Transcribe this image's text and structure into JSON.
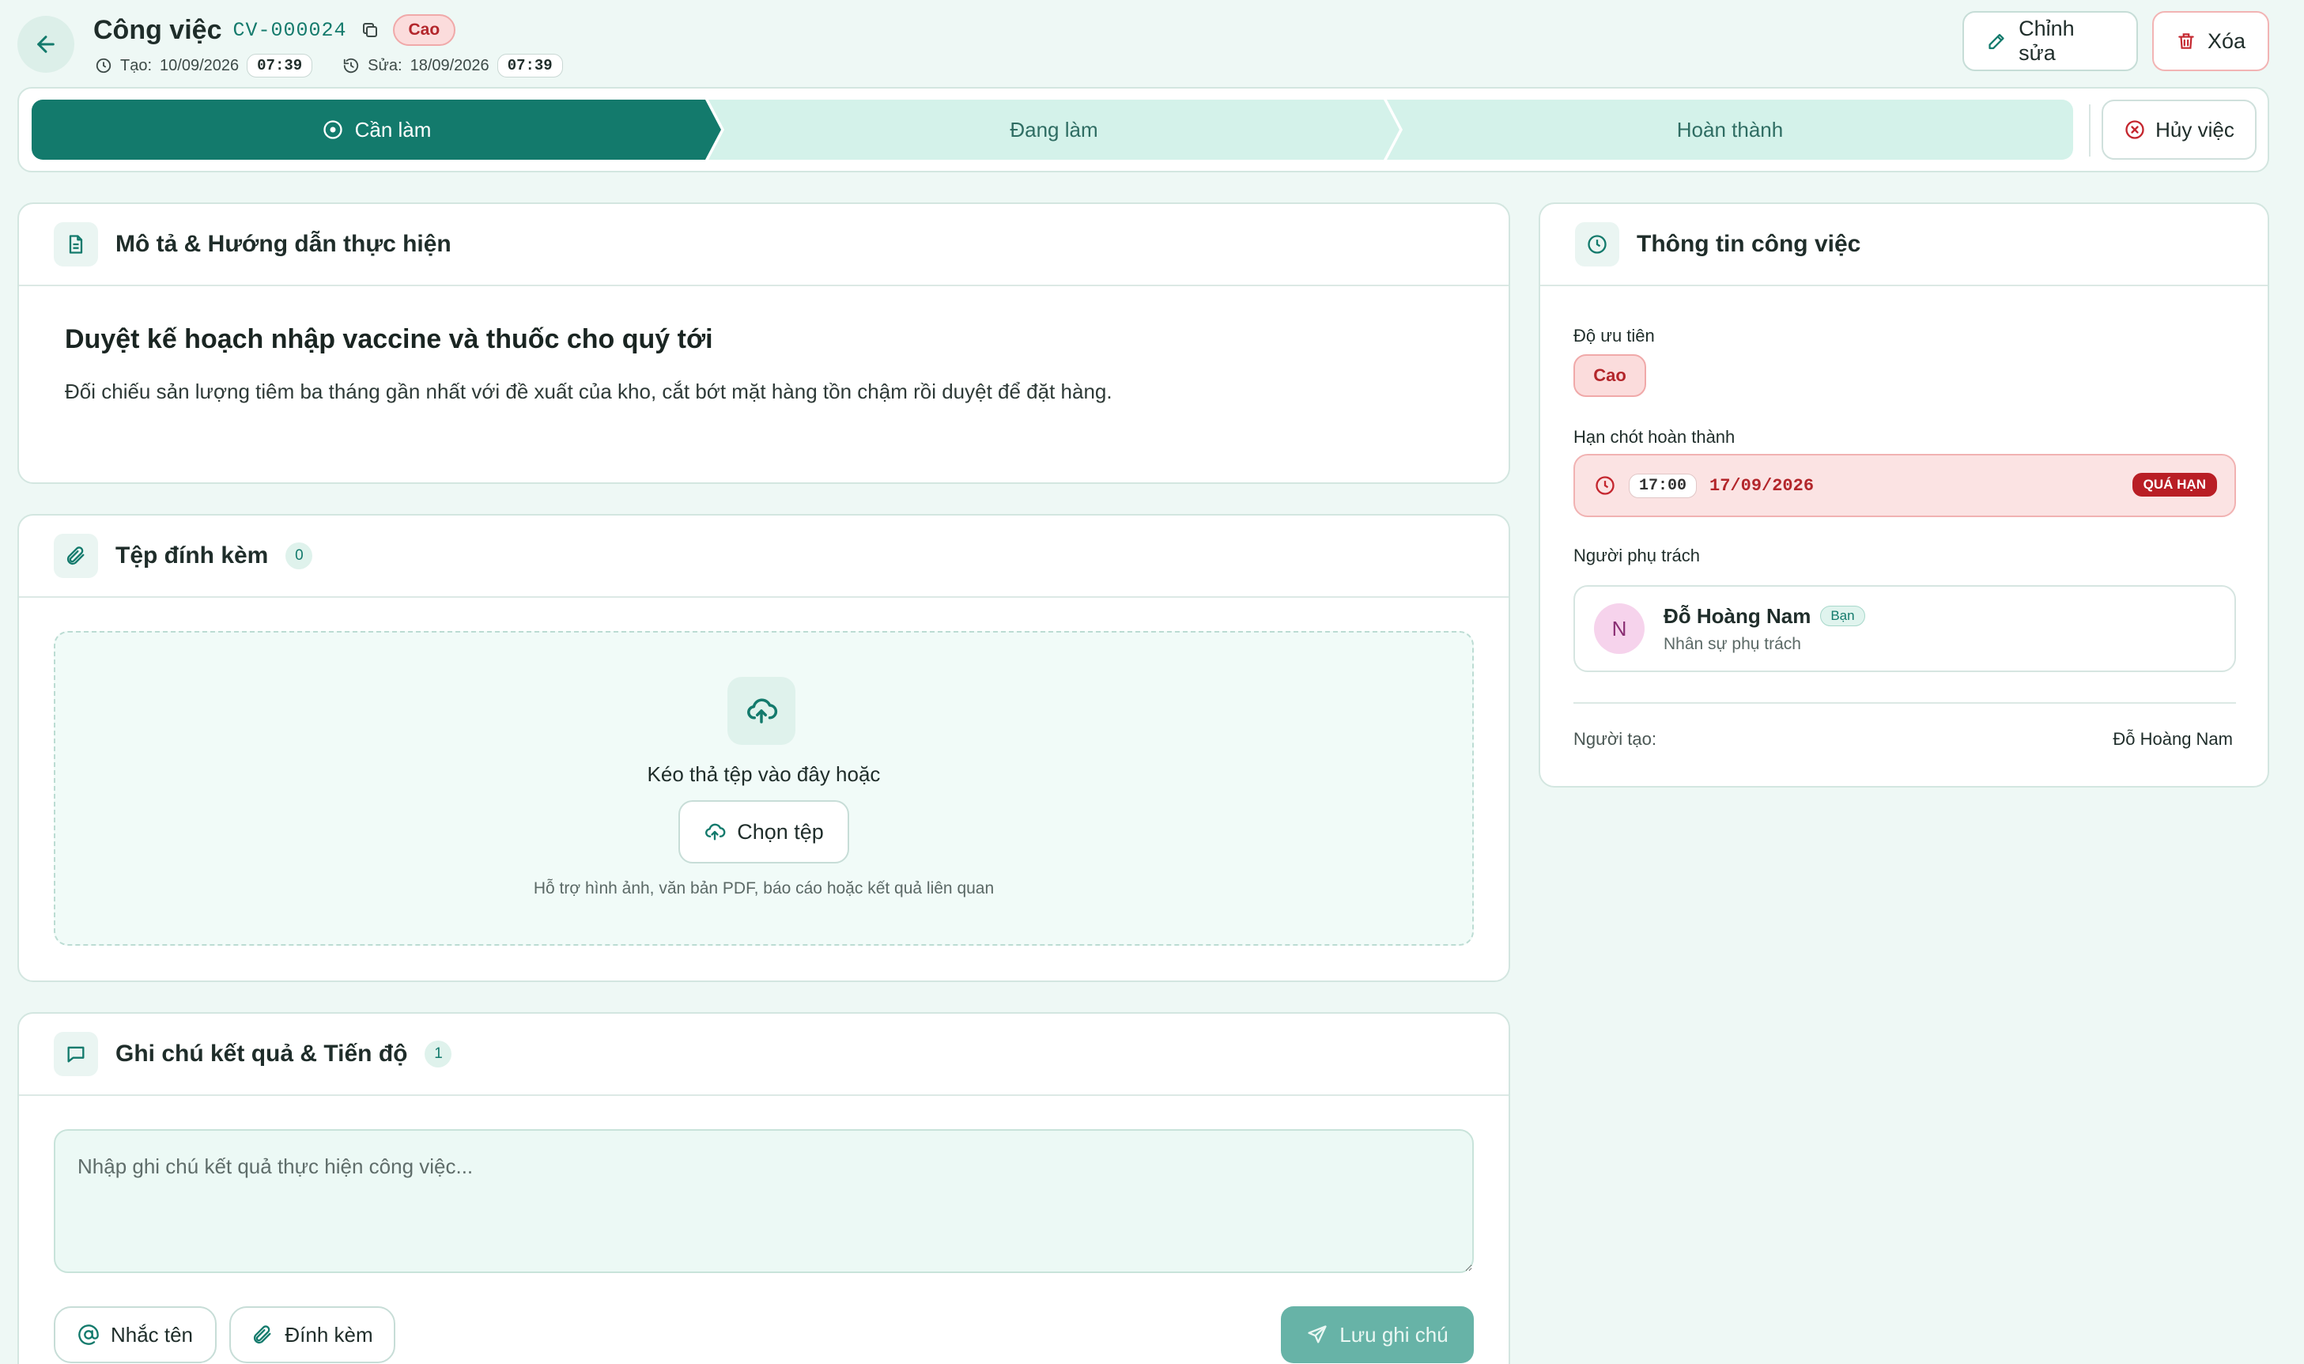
{
  "header": {
    "title": "Công việc",
    "code": "CV-000024",
    "priority_badge": "Cao",
    "created_label": "Tạo:",
    "created_date": "10/09/2026",
    "created_time": "07:39",
    "updated_label": "Sửa:",
    "updated_date": "18/09/2026",
    "updated_time": "07:39",
    "edit_label": "Chỉnh sửa",
    "delete_label": "Xóa"
  },
  "stepper": {
    "steps": [
      {
        "label": "Cần làm",
        "active": true
      },
      {
        "label": "Đang làm",
        "active": false
      },
      {
        "label": "Hoàn thành",
        "active": false
      }
    ],
    "cancel_label": "Hủy việc"
  },
  "description": {
    "title": "Mô tả & Hướng dẫn thực hiện",
    "heading": "Duyệt kế hoạch nhập vaccine và thuốc cho quý tới",
    "body": "Đối chiếu sản lượng tiêm ba tháng gần nhất với đề xuất của kho, cắt bớt mặt hàng tồn chậm rồi duyệt để đặt hàng."
  },
  "attachments": {
    "title": "Tệp đính kèm",
    "count": "0",
    "drop_text": "Kéo thả tệp vào đây hoặc",
    "choose_label": "Chọn tệp",
    "hint": "Hỗ trợ hình ảnh, văn bản PDF, báo cáo hoặc kết quả liên quan"
  },
  "notes": {
    "title": "Ghi chú kết quả & Tiến độ",
    "count": "1",
    "placeholder": "Nhập ghi chú kết quả thực hiện công việc...",
    "mention_label": "Nhắc tên",
    "attach_label": "Đính kèm",
    "save_label": "Lưu ghi chú"
  },
  "info": {
    "title": "Thông tin công việc",
    "priority_label": "Độ ưu tiên",
    "priority_value": "Cao",
    "deadline_label": "Hạn chót hoàn thành",
    "deadline_time": "17:00",
    "deadline_date": "17/09/2026",
    "overdue_tag": "QUÁ HẠN",
    "assignee_label": "Người phụ trách",
    "assignee_initial": "N",
    "assignee_name": "Đỗ Hoàng Nam",
    "assignee_you": "Bạn",
    "assignee_role": "Nhân sự phụ trách",
    "creator_label": "Người tạo:",
    "creator_name": "Đỗ Hoàng Nam"
  },
  "colors": {
    "primary": "#137a6c",
    "step_inactive": "#d4f2ea",
    "danger": "#b91e25",
    "page_bg": "#eef8f5"
  },
  "icons": {
    "back": "arrow-left-icon",
    "copy": "copy-icon",
    "clock": "clock-icon",
    "history": "history-icon",
    "edit": "pencil-icon",
    "delete": "trash-icon",
    "cancel": "x-circle-icon",
    "description": "document-icon",
    "attachments": "paperclip-icon",
    "upload": "cloud-upload-icon",
    "notes": "message-square-icon",
    "mention": "at-sign-icon",
    "send": "send-icon"
  }
}
